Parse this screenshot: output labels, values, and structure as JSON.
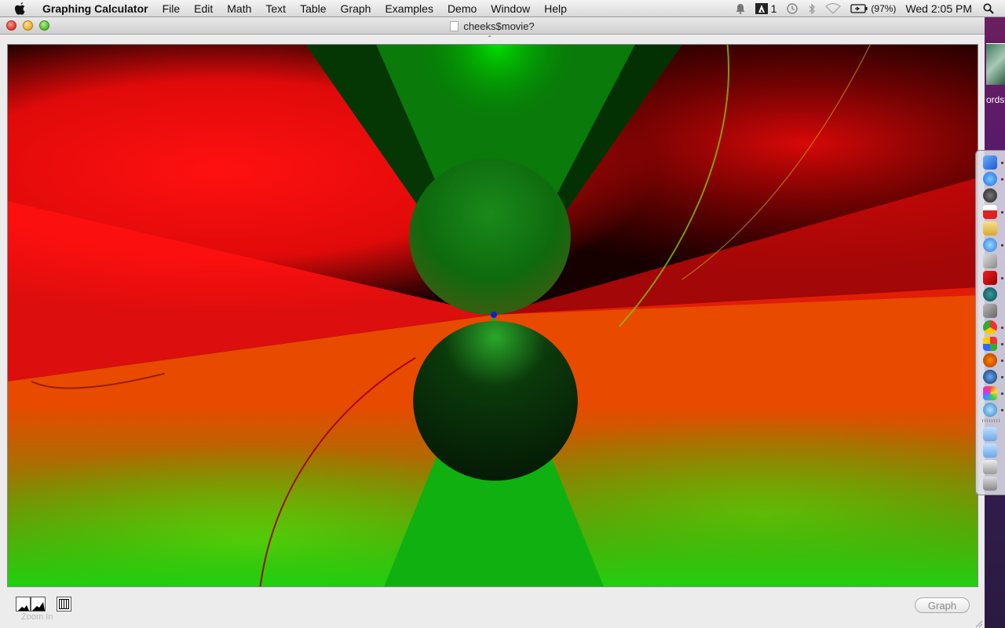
{
  "menubar": {
    "app_name": "Graphing Calculator",
    "menus": [
      "File",
      "Edit",
      "Math",
      "Text",
      "Table",
      "Graph",
      "Examples",
      "Demo",
      "Window",
      "Help"
    ],
    "status": {
      "adobe_count": "1",
      "battery": "(97%)",
      "clock": "Wed 2:05 PM"
    }
  },
  "desktop": {
    "label": "ords"
  },
  "window": {
    "title": "cheeks$movie?",
    "toolbar_toggle": "ˆ",
    "zoom_label": "Zoom In",
    "graph_button": "Graph"
  },
  "colors": {
    "red": "#ff1010",
    "green": "#10c010",
    "yellow": "#d0d000",
    "dark": "#000000"
  },
  "dock": {
    "icons": [
      "finder-icon",
      "app-store-icon",
      "dashboard-icon",
      "calendar-icon",
      "notes-icon",
      "itunes-icon",
      "photos-icon",
      "photo-booth-icon",
      "time-machine-icon",
      "preferences-icon",
      "chrome-icon",
      "picasa-icon",
      "firefox-icon",
      "safari-alt-icon",
      "grapher-icon",
      "safari-icon",
      "applications-folder-icon",
      "documents-folder-icon",
      "screen-icon",
      "trash-icon"
    ]
  }
}
